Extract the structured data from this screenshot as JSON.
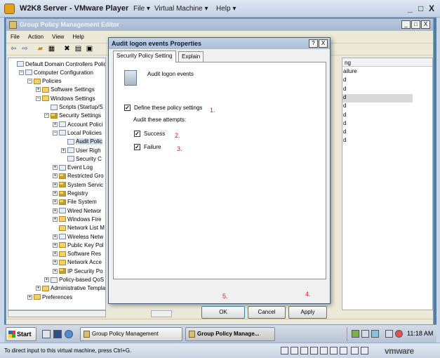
{
  "vmware": {
    "title": "W2K8 Server - VMware Player",
    "menus": [
      "File ▾",
      "Virtual Machine ▾",
      "Help ▾"
    ],
    "controls": [
      "_",
      "□",
      "X"
    ],
    "status_text": "To direct input to this virtual machine, press Ctrl+G.",
    "brand": "vmware"
  },
  "gpmc": {
    "title": "Group Policy Management Editor",
    "controls": [
      "_",
      "□",
      "X"
    ],
    "menus": [
      "File",
      "Action",
      "View",
      "Help"
    ],
    "tree": [
      {
        "label": "Default Domain Controllers Policy",
        "indent": 0,
        "exp": "",
        "icon": "doc"
      },
      {
        "label": "Computer Configuration",
        "indent": 1,
        "exp": "−",
        "icon": "doc"
      },
      {
        "label": "Policies",
        "indent": 2,
        "exp": "−",
        "icon": "folder"
      },
      {
        "label": "Software Settings",
        "indent": 3,
        "exp": "+",
        "icon": "folder"
      },
      {
        "label": "Windows Settings",
        "indent": 3,
        "exp": "−",
        "icon": "folder"
      },
      {
        "label": "Scripts (Startup/S",
        "indent": 4,
        "exp": "",
        "icon": "doc"
      },
      {
        "label": "Security Settings",
        "indent": 4,
        "exp": "−",
        "icon": "lock"
      },
      {
        "label": "Account Polici",
        "indent": 5,
        "exp": "+",
        "icon": "doc"
      },
      {
        "label": "Local Policies",
        "indent": 5,
        "exp": "−",
        "icon": "doc"
      },
      {
        "label": "Audit Polic",
        "indent": 6,
        "exp": "",
        "icon": "doc",
        "selected": true
      },
      {
        "label": "User Righ",
        "indent": 6,
        "exp": "+",
        "icon": "doc"
      },
      {
        "label": "Security C",
        "indent": 6,
        "exp": "",
        "icon": "doc"
      },
      {
        "label": "Event Log",
        "indent": 5,
        "exp": "+",
        "icon": "doc"
      },
      {
        "label": "Restricted Gro",
        "indent": 5,
        "exp": "+",
        "icon": "lock"
      },
      {
        "label": "System Servic",
        "indent": 5,
        "exp": "+",
        "icon": "lock"
      },
      {
        "label": "Registry",
        "indent": 5,
        "exp": "+",
        "icon": "lock"
      },
      {
        "label": "File System",
        "indent": 5,
        "exp": "+",
        "icon": "lock"
      },
      {
        "label": "Wired Networ",
        "indent": 5,
        "exp": "+",
        "icon": "doc"
      },
      {
        "label": "Windows Fire",
        "indent": 5,
        "exp": "+",
        "icon": "folder"
      },
      {
        "label": "Network List M",
        "indent": 5,
        "exp": "",
        "icon": "folder"
      },
      {
        "label": "Wireless Netw",
        "indent": 5,
        "exp": "+",
        "icon": "doc"
      },
      {
        "label": "Public Key Pol",
        "indent": 5,
        "exp": "+",
        "icon": "folder"
      },
      {
        "label": "Software Res",
        "indent": 5,
        "exp": "+",
        "icon": "folder"
      },
      {
        "label": "Network Acce",
        "indent": 5,
        "exp": "+",
        "icon": "folder"
      },
      {
        "label": "IP Security Po",
        "indent": 5,
        "exp": "+",
        "icon": "lock"
      },
      {
        "label": "Policy-based QoS",
        "indent": 4,
        "exp": "+",
        "icon": "doc"
      },
      {
        "label": "Administrative Templa",
        "indent": 3,
        "exp": "+",
        "icon": "folder"
      },
      {
        "label": "Preferences",
        "indent": 2,
        "exp": "+",
        "icon": "folder"
      }
    ],
    "right_pane": {
      "header": "ng",
      "cells": [
        "ailure",
        "d",
        "d",
        "d",
        "d",
        "d",
        "d",
        "d",
        "d"
      ],
      "selected_index": 3
    }
  },
  "dialog": {
    "title": "Audit logon events Properties",
    "help": "?",
    "close": "X",
    "tabs": [
      "Security Policy Setting",
      "Explain"
    ],
    "policy_name": "Audit logon events",
    "define_label": "Define these policy settings",
    "define_checked": "✓",
    "audit_heading": "Audit these attempts:",
    "success_label": "Success",
    "success_checked": "✓",
    "failure_label": "Failure",
    "failure_checked": "✓",
    "annotations": [
      "1.",
      "2.",
      "3.",
      "4.",
      "5."
    ],
    "buttons": {
      "ok": "OK",
      "cancel": "Cancel",
      "apply": "Apply"
    }
  },
  "taskbar": {
    "start": "Start",
    "tasks": [
      "Group Policy Management",
      "Group Policy Manage..."
    ],
    "clock": "11:18 AM"
  }
}
